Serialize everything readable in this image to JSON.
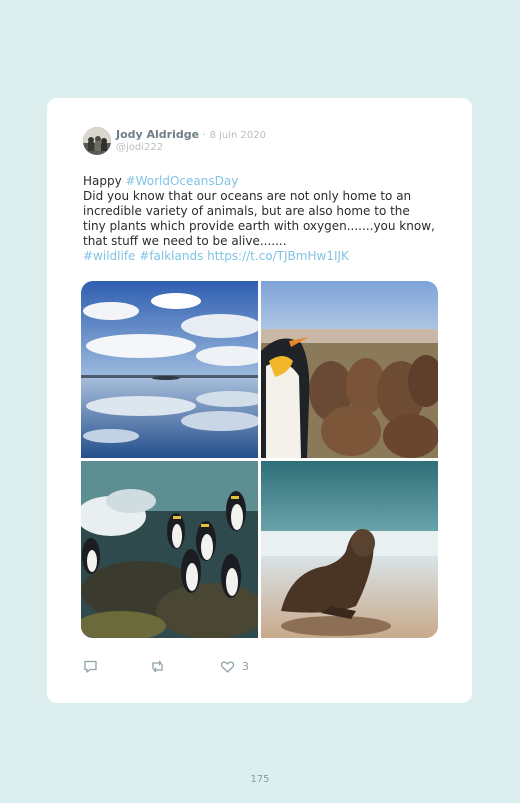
{
  "tweet": {
    "author_name": "Jody Aldridge",
    "separator": " · ",
    "date": "8 juin 2020",
    "handle": "@jodi222",
    "text_prefix": "Happy ",
    "hashtag_main": "#WorldOceansDay",
    "body": "Did you know that our oceans are not only home to an incredible variety of animals, but are also home to the tiny plants which provide earth with oxygen.......you know, that stuff we need to be alive.......",
    "hashtag_wildlife": "#wildlife",
    "hashtag_falklands": "#falklands",
    "link": "https://t.co/TJBmHw1IJK",
    "link_color": "#7fc4e6",
    "likes": "3"
  },
  "icons": {
    "reply": "reply-icon",
    "retweet": "retweet-icon",
    "like": "heart-icon"
  },
  "page": {
    "number": "175"
  }
}
